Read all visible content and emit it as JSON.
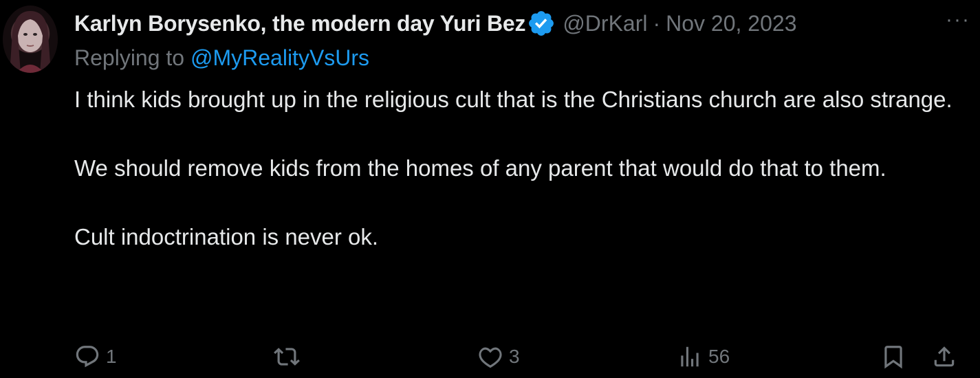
{
  "tweet": {
    "author_name": "Karlyn Borysenko, the modern day Yuri Bez",
    "handle": "@DrKarl",
    "separator": "·",
    "date": "Nov 20, 2023",
    "more_label": "···",
    "replying_prefix": "Replying to",
    "replying_to": "@MyRealityVsUrs",
    "paragraphs": [
      "I think kids brought up in the religious cult that is the Christians church are also strange.",
      "We should remove kids from the homes of any parent that would do that to them.",
      "Cult indoctrination is never ok."
    ]
  },
  "actions": {
    "reply_count": "1",
    "retweet_count": "",
    "like_count": "3",
    "views_count": "56"
  },
  "icons": {
    "verified": "verified-badge-icon",
    "reply": "reply-icon",
    "retweet": "retweet-icon",
    "like": "heart-icon",
    "views": "views-icon",
    "bookmark": "bookmark-icon",
    "share": "share-icon"
  },
  "colors": {
    "background": "#000000",
    "text": "#e7e9ea",
    "muted": "#71767b",
    "accent": "#1d9bf0"
  }
}
